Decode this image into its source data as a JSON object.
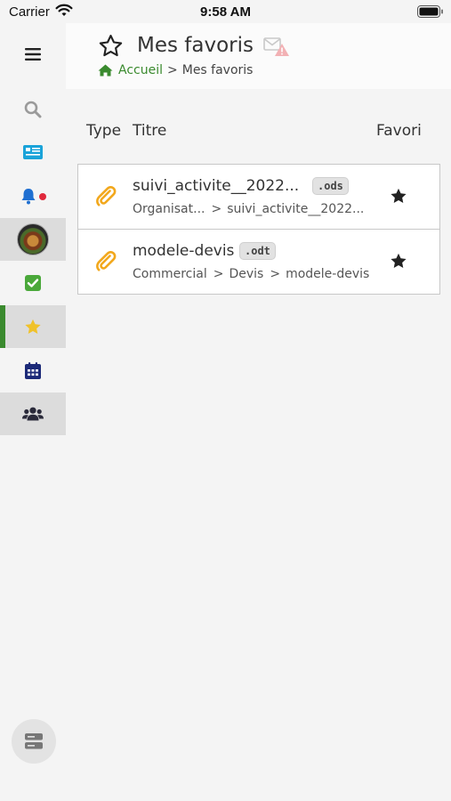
{
  "status": {
    "carrier": "Carrier",
    "time": "9:58 AM"
  },
  "header": {
    "title": "Mes favoris",
    "breadcrumb": {
      "home": "Accueil",
      "separator": ">",
      "current": "Mes favoris"
    }
  },
  "columns": {
    "type": "Type",
    "title": "Titre",
    "favorite": "Favori"
  },
  "rows": [
    {
      "title": "suivi_activite__2022...",
      "ext": ".ods",
      "path": [
        "Organisat...",
        "suivi_activite__2022..."
      ]
    },
    {
      "title": "modele-devis",
      "ext": ".odt",
      "path": [
        "Commercial",
        "Devis",
        "modele-devis"
      ]
    }
  ],
  "sidebar": {
    "items": [
      "menu-icon",
      "search-icon",
      "news-icon",
      "bell-icon",
      "avatar",
      "tasks-icon",
      "star-icon",
      "calendar-icon",
      "users-icon"
    ],
    "active": "star-icon"
  },
  "colors": {
    "accent_green": "#3a8a2e",
    "file_icon": "#f2a81d",
    "notification_dot": "#e0283c",
    "news_blue": "#1aa3d9",
    "calendar_navy": "#1c2a78",
    "star_yellow": "#f0c22a",
    "check_green": "#4aa83a"
  }
}
